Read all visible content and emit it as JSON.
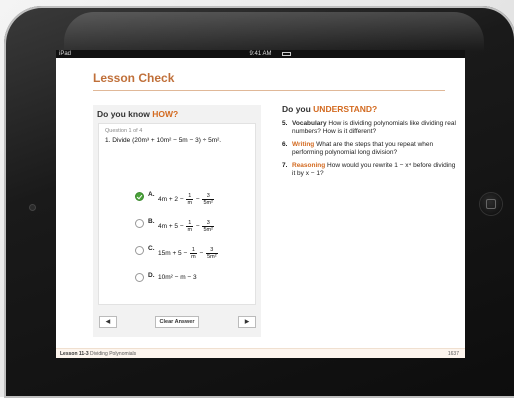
{
  "status_bar": {
    "device": "iPad",
    "time": "9:41 AM"
  },
  "lesson": {
    "title": "Lesson Check"
  },
  "left_panel": {
    "heading_pre": "Do you know ",
    "heading_accent": "HOW?",
    "question_counter": "Question 1 of 4",
    "question_text": "1. Divide (20m³ + 10m² − 5m − 3) ÷ 5m².",
    "options": [
      {
        "letter": "A.",
        "lead": "4m + 2 − ",
        "f1n": "1",
        "f1d": "m",
        "mid": " − ",
        "f2n": "3",
        "f2d": "5m²",
        "selected": true
      },
      {
        "letter": "B.",
        "lead": "4m + 5 − ",
        "f1n": "1",
        "f1d": "m",
        "mid": " − ",
        "f2n": "3",
        "f2d": "5m²",
        "selected": false
      },
      {
        "letter": "C.",
        "lead": "15m + 5 − ",
        "f1n": "1",
        "f1d": "m",
        "mid": " − ",
        "f2n": "3",
        "f2d": "5m²",
        "selected": false
      },
      {
        "letter": "D.",
        "lead": "10m² − m − 3",
        "selected": false
      }
    ],
    "prev_label": "◀",
    "clear_label": "Clear Answer",
    "next_label": "▶"
  },
  "right_panel": {
    "heading_pre": "Do you ",
    "heading_accent": "UNDERSTAND?",
    "items": [
      {
        "num": "5.",
        "keyword": "Vocabulary",
        "text": " How is dividing polynomials like dividing real numbers? How is it different?"
      },
      {
        "num": "6.",
        "keyword": "Writing",
        "text": " What are the steps that you repeat when performing polynomial long division?"
      },
      {
        "num": "7.",
        "keyword": "Reasoning",
        "text": " How would you rewrite 1 − x⁴ before dividing it by x − 1?"
      }
    ]
  },
  "footer": {
    "lesson_label": "Lesson 11-3",
    "lesson_name": "Dividing Polynomials",
    "page": "1637"
  },
  "colors": {
    "accent": "#d36a20",
    "title": "#c0703a",
    "selected": "#4aa23a"
  }
}
